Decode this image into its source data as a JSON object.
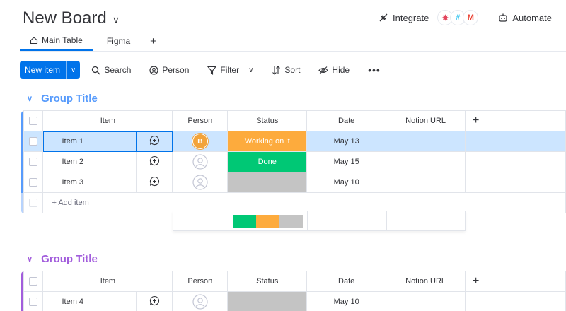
{
  "board": {
    "title": "New Board"
  },
  "header": {
    "integrate_label": "Integrate",
    "automate_label": "Automate",
    "integrations": [
      "gmail-app",
      "slack-app",
      "gmail-m"
    ]
  },
  "tabs": [
    {
      "label": "Main Table",
      "active": true
    },
    {
      "label": "Figma",
      "active": false
    }
  ],
  "toolbar": {
    "new_item_label": "New item",
    "search_label": "Search",
    "person_label": "Person",
    "filter_label": "Filter",
    "sort_label": "Sort",
    "hide_label": "Hide"
  },
  "columns": {
    "item": "Item",
    "person": "Person",
    "status": "Status",
    "date": "Date",
    "notion_url": "Notion URL"
  },
  "colors": {
    "accent": "#0073ea",
    "group1": "#579bfc",
    "group2": "#a25ddc",
    "working": "#fdab3d",
    "done": "#00c875",
    "empty": "#c4c4c4"
  },
  "groups": [
    {
      "title": "Group Title",
      "add_item_label": "+ Add item",
      "rows": [
        {
          "name": "Item 1",
          "person": "B",
          "status": "Working on it",
          "date": "May 13",
          "selected": true
        },
        {
          "name": "Item 2",
          "person": "",
          "status": "Done",
          "date": "May 15",
          "selected": false
        },
        {
          "name": "Item 3",
          "person": "",
          "status": "",
          "date": "May 10",
          "selected": false
        }
      ],
      "status_summary": {
        "done": 0.333,
        "working": 0.333,
        "empty": 0.334
      }
    },
    {
      "title": "Group Title",
      "rows": [
        {
          "name": "Item 4",
          "person": "",
          "status": "",
          "date": "May 10",
          "selected": false
        }
      ]
    }
  ]
}
